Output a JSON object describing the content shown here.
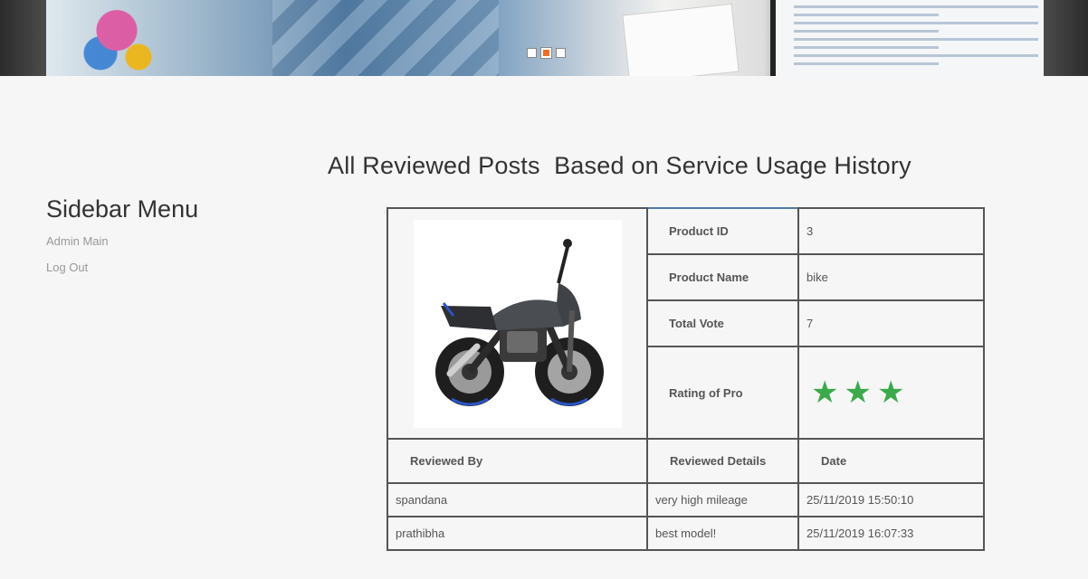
{
  "banner": {
    "slides": [
      "slide-1",
      "slide-2",
      "slide-3"
    ],
    "active_slide": 2
  },
  "page": {
    "title": "All Reviewed Posts  Based on Service Usage History"
  },
  "sidebar": {
    "title": "Sidebar Menu",
    "items": [
      {
        "label": "Admin Main"
      },
      {
        "label": "Log Out"
      }
    ]
  },
  "product": {
    "image_alt": "motorcycle",
    "fields": [
      {
        "label": "Product ID",
        "value": "3"
      },
      {
        "label": "Product Name",
        "value": "bike"
      },
      {
        "label": "Total Vote",
        "value": "7"
      },
      {
        "label": "Rating of Pro",
        "stars": 3
      }
    ],
    "star_color": "#3aaa4a"
  },
  "reviews": {
    "columns": [
      "Reviewed By",
      "Reviewed Details",
      "Date"
    ],
    "rows": [
      {
        "by": "spandana",
        "details": "very high mileage",
        "date": "25/11/2019 15:50:10"
      },
      {
        "by": "prathibha",
        "details": "best model!",
        "date": "25/11/2019 16:07:33"
      }
    ]
  },
  "colors": {
    "label_blue": "#3a75a8",
    "background": "#f6f6f6",
    "accent_orange": "#f26c22"
  }
}
